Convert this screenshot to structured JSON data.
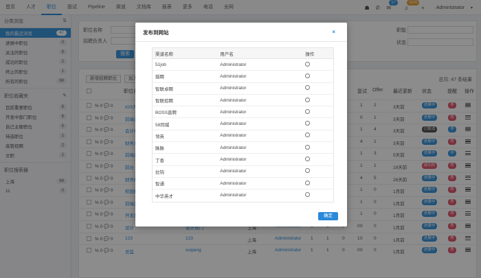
{
  "nav": {
    "items": [
      "首页",
      "人才",
      "职位",
      "面试",
      "Pipeline",
      "渠道",
      "文档库",
      "报表",
      "更多",
      "电话",
      "全网"
    ],
    "active_index": 2,
    "msg_badge": "17",
    "notif_badge": "1870",
    "user": "Administrator"
  },
  "sidebar": {
    "head": "分类浏览",
    "items": [
      {
        "label": "我的最近浏览",
        "count": "47",
        "active": true
      },
      {
        "label": "进展中职位",
        "count": "0"
      },
      {
        "label": "关注的职位",
        "count": "6"
      },
      {
        "label": "成功的职位",
        "count": "2"
      },
      {
        "label": "终止的职位",
        "count": "1"
      },
      {
        "label": "所有的职位",
        "count": "68"
      }
    ],
    "fav_head": "职位收藏夹",
    "fav_items": [
      {
        "label": "目前重要职位",
        "count": "6"
      },
      {
        "label": "开发中部门职位",
        "count": "6"
      },
      {
        "label": "自己主衡职位",
        "count": "5"
      },
      {
        "label": "待选职位",
        "count": "1"
      },
      {
        "label": "高管招聘",
        "count": "2"
      },
      {
        "label": "文职",
        "count": "1"
      }
    ],
    "search_head": "职位搜索器",
    "search_items": [
      {
        "label": "上海",
        "count": "68"
      },
      {
        "label": "11",
        "count": "0"
      }
    ]
  },
  "filter": {
    "job_name_label": "职位名称",
    "recruiter_label": "招聘负责人",
    "level_label": "职能",
    "status_label": "状态",
    "search_btn": "搜索"
  },
  "list": {
    "new_btn": "新增招聘职位",
    "add_btn": "加入",
    "total": "总共: 47 条结果",
    "headers": {
      "job": "职位名称",
      "interview": "复试",
      "offer": "Offer",
      "updated": "最近更新",
      "status": "状态",
      "remind": "提醒",
      "ops": "操作"
    },
    "rows": [
      {
        "name": "IOS开发",
        "interview": "1",
        "offer": "2",
        "updated": "3天前",
        "status": "进展中",
        "status_color": "#3c95db",
        "tag": "荐",
        "tag_color": "#e05a6f"
      },
      {
        "name": "前端开发",
        "interview": "0",
        "offer": "1",
        "updated": "3天前",
        "status": "进展中",
        "status_color": "#3c95db",
        "tag": "荐",
        "tag_color": "#e05a6f"
      },
      {
        "name": "会计师",
        "interview": "1",
        "offer": "4",
        "updated": "3天前",
        "status": "已取消",
        "status_color": "#555555",
        "tag": "荐",
        "tag_color": "#3c95db"
      },
      {
        "name": "财务总监",
        "interview": "4",
        "offer": "1",
        "updated": "3天前",
        "status": "进展中",
        "status_color": "#3c95db",
        "tag": "荐",
        "tag_color": "#e05a6f"
      },
      {
        "name": "前端开发",
        "interview": "1",
        "offer": "3",
        "updated": "5天前",
        "status": "进展中",
        "status_color": "#3c95db",
        "tag": "中",
        "tag_color": "#3c95db"
      },
      {
        "name": "前台",
        "interview": "1",
        "offer": "1",
        "updated": "19天前",
        "status": "成功的",
        "status_color": "#e05a6f",
        "tag": "荐",
        "tag_color": "#e05a6f"
      },
      {
        "name": "财务经理",
        "interview": "4",
        "offer": "5",
        "updated": "26天前",
        "status": "进展中",
        "status_color": "#3c95db",
        "tag": "荐",
        "tag_color": "#e05a6f"
      },
      {
        "name": "校园招聘",
        "interview": "1",
        "offer": "0",
        "updated": "1月前",
        "status": "进展中",
        "status_color": "#3c95db",
        "tag": "荐",
        "tag_color": "#e05a6f"
      },
      {
        "name": "前端开发",
        "interview": "1",
        "offer": "0",
        "updated": "1月前",
        "status": "进展中",
        "status_color": "#3c95db",
        "tag": "荐",
        "tag_color": "#e05a6f"
      },
      {
        "name": "开发部",
        "interview": "1",
        "offer": "0",
        "updated": "1月前",
        "status": "进展中",
        "status_color": "#3c95db",
        "tag": "荐",
        "tag_color": "#e05a6f"
      },
      {
        "name": "设计",
        "dept": "设计部门",
        "city": "上海",
        "owner": "Administrator",
        "n1": "1",
        "n2": "1",
        "n3": "0",
        "n4": "0",
        "interview": "0",
        "offer": "0",
        "updated": "1月前",
        "status": "进展中",
        "status_color": "#3c95db",
        "tag": "荐",
        "tag_color": "#e05a6f"
      },
      {
        "name": "123",
        "dept": "123",
        "city": "上海",
        "owner": "Administrator",
        "n1": "1",
        "n2": "1",
        "n3": "0",
        "n4": "1",
        "interview": "0",
        "offer": "0",
        "updated": "1月前",
        "status": "进展中",
        "status_color": "#3c95db",
        "tag": "荐",
        "tag_color": "#e05a6f"
      },
      {
        "name": "总监",
        "dept": "xuqiang",
        "city": "上海",
        "owner": "Administrator",
        "n1": "1",
        "n2": "1",
        "n3": "0",
        "n4": "0",
        "interview": "0",
        "offer": "0",
        "updated": "1月前",
        "status": "进展中",
        "status_color": "#3c95db",
        "tag": "荐",
        "tag_color": "#e05a6f"
      }
    ]
  },
  "modal": {
    "title": "发布到网站",
    "close": "×",
    "col_channel": "渠道名称",
    "col_user": "用户名",
    "col_op": "操作",
    "rows": [
      {
        "channel": "51job",
        "user": "Administrator"
      },
      {
        "channel": "猎聘",
        "user": "Administrator"
      },
      {
        "channel": "智联卓聘",
        "user": "Administrator"
      },
      {
        "channel": "智联招聘",
        "user": "Administrator"
      },
      {
        "channel": "BOSS直聘",
        "user": "Administrator"
      },
      {
        "channel": "58同城",
        "user": "Administrator"
      },
      {
        "channel": "领英",
        "user": "Administrator"
      },
      {
        "channel": "脉脉",
        "user": "Administrator"
      },
      {
        "channel": "丁香",
        "user": "Administrator"
      },
      {
        "channel": "拉钩",
        "user": "Administrator"
      },
      {
        "channel": "智通",
        "user": "Administrator"
      },
      {
        "channel": "中华英才",
        "user": "Administrator"
      }
    ],
    "ok": "确定"
  }
}
